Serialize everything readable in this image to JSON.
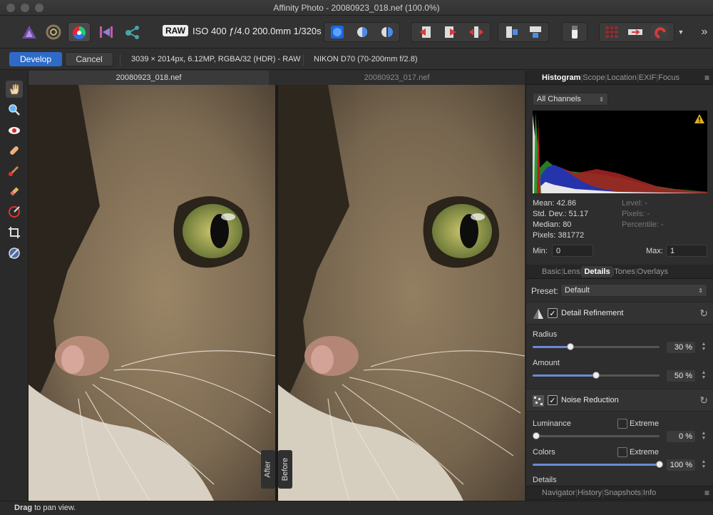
{
  "window": {
    "title": "Affinity Photo - 20080923_018.nef (100.0%)"
  },
  "toolbar": {
    "raw_badge": "RAW",
    "exposure_info": "ISO 400 ƒ/4.0 200.0mm 1/320s"
  },
  "context": {
    "develop_label": "Develop",
    "cancel_label": "Cancel",
    "image_info": "3039 × 2014px, 6.12MP, RGBA/32 (HDR) - RAW",
    "camera_info": "NIKON D70 (70-200mm f/2.8)"
  },
  "documents": {
    "left_tab": "20080923_018.nef",
    "right_tab": "20080923_017.nef",
    "after_label": "After",
    "before_label": "Before"
  },
  "panel_top": {
    "tabs": [
      "Histogram",
      "Scope",
      "Location",
      "EXIF",
      "Focus"
    ],
    "active_tab": "Histogram",
    "channel": "All Channels",
    "mean": "Mean: 42.86",
    "std_dev": "Std. Dev.: 51.17",
    "median": "Median: 80",
    "pixels": "Pixels: 381772",
    "level": "Level: -",
    "pixels_sel": "Pixels: -",
    "percentile": "Percentile: -",
    "min_label": "Min:",
    "min_value": "0",
    "max_label": "Max:",
    "max_value": "1"
  },
  "develop": {
    "tabs": [
      "Basic",
      "Lens",
      "Details",
      "Tones",
      "Overlays"
    ],
    "active_tab": "Details",
    "preset_label": "Preset:",
    "preset_value": "Default",
    "detail_refinement": {
      "title": "Detail Refinement",
      "enabled": true,
      "radius_label": "Radius",
      "radius_value": "30 %",
      "radius": 0.3,
      "amount_label": "Amount",
      "amount_value": "50 %",
      "amount": 0.5
    },
    "noise_reduction": {
      "title": "Noise Reduction",
      "enabled": true,
      "luminance_label": "Luminance",
      "luminance_value": "0 %",
      "luminance": 0.0,
      "colors_label": "Colors",
      "colors_value": "100 %",
      "colors": 1.0,
      "extreme_label": "Extreme",
      "details_label": "Details"
    }
  },
  "panel_bottom": {
    "tabs": [
      "Navigator",
      "History",
      "Snapshots",
      "Info"
    ]
  },
  "status": {
    "bold": "Drag",
    "rest": " to pan view."
  },
  "colors": {
    "accent": "#2e6bc8",
    "slider": "#6a8bd4",
    "active_toggle": "#1c66e0"
  }
}
